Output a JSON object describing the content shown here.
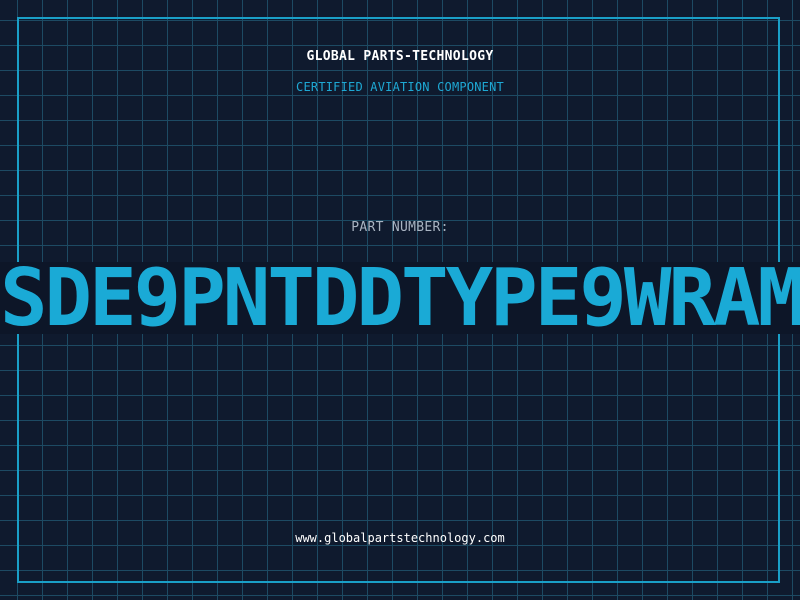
{
  "header": {
    "company": "GLOBAL PARTS-TECHNOLOGY",
    "subtitle": "CERTIFIED AVIATION COMPONENT"
  },
  "part": {
    "label": "PART NUMBER:",
    "number": "SDE9PNTDDTYPE9WRAM"
  },
  "footer": {
    "website": "www.globalpartstechnology.com"
  },
  "colors": {
    "background": "#0f1a2e",
    "grid": "#1d4a63",
    "accent": "#1aaad6",
    "frame": "#1a9fc7",
    "text": "#ffffff",
    "label": "#a9b4c2"
  }
}
